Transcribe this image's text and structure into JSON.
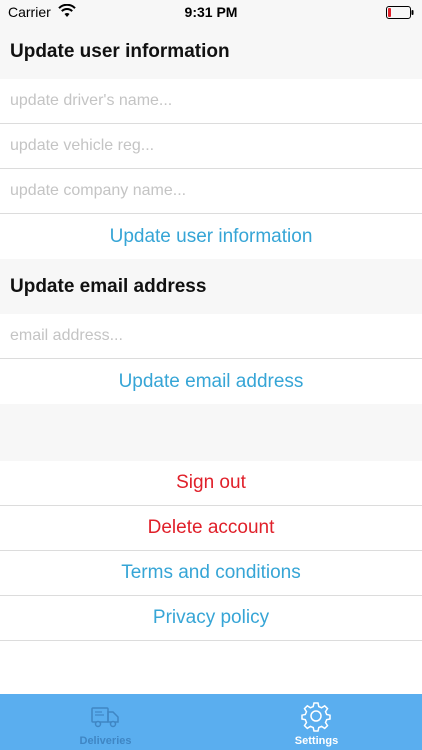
{
  "status_bar": {
    "carrier": "Carrier",
    "time": "9:31 PM"
  },
  "user_info": {
    "header": "Update user information",
    "driver_name_placeholder": "update driver's name...",
    "vehicle_reg_placeholder": "update vehicle reg...",
    "company_name_placeholder": "update company name...",
    "update_button": "Update user information"
  },
  "email": {
    "header": "Update email address",
    "email_placeholder": "email address...",
    "update_button": "Update email address"
  },
  "account": {
    "sign_out": "Sign out",
    "delete_account": "Delete account",
    "terms": "Terms and conditions",
    "privacy": "Privacy policy"
  },
  "tab_bar": {
    "tabs": [
      {
        "label": "Deliveries",
        "icon": "truck-icon",
        "active": false
      },
      {
        "label": "Settings",
        "icon": "gear-icon",
        "active": true
      }
    ]
  },
  "colors": {
    "link_blue": "#36a5d6",
    "destructive_red": "#e0202a",
    "tab_bar": "#5aaeef"
  }
}
